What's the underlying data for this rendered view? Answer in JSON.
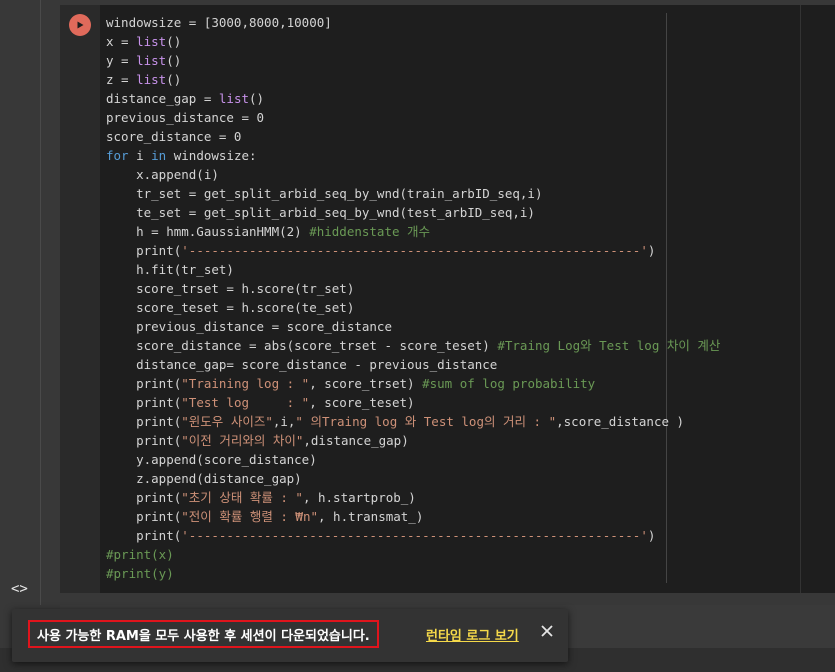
{
  "colors": {
    "string": "#ce9178",
    "comment": "#6a9955",
    "keyword": "#569cd6",
    "builtin": "#c792ea",
    "text": "#d4d4d4",
    "run_button": "#e06a5b",
    "toast_border": "#e0141c",
    "toast_link": "#f5d94a"
  },
  "left_rail": {
    "toggle_icon": "<>"
  },
  "cell": {
    "run_icon": "play-icon",
    "code_lines": [
      [
        [
          "windowsize = [3000,8000,10000]",
          "t"
        ]
      ],
      [
        [
          "x = ",
          "t"
        ],
        [
          "list",
          "b"
        ],
        [
          "()",
          "t"
        ]
      ],
      [
        [
          "y = ",
          "t"
        ],
        [
          "list",
          "b"
        ],
        [
          "()",
          "t"
        ]
      ],
      [
        [
          "z = ",
          "t"
        ],
        [
          "list",
          "b"
        ],
        [
          "()",
          "t"
        ]
      ],
      [
        [
          "distance_gap = ",
          "t"
        ],
        [
          "list",
          "b"
        ],
        [
          "()",
          "t"
        ]
      ],
      [
        [
          "previous_distance = 0",
          "t"
        ]
      ],
      [
        [
          "score_distance = 0",
          "t"
        ]
      ],
      [
        [
          "for",
          "k"
        ],
        [
          " i ",
          "t"
        ],
        [
          "in",
          "k"
        ],
        [
          " windowsize:",
          "t"
        ]
      ],
      [
        [
          "    x.append(i)",
          "t"
        ]
      ],
      [
        [
          "    tr_set = get_split_arbid_seq_by_wnd(train_arbID_seq,i)",
          "t"
        ]
      ],
      [
        [
          "    te_set = get_split_arbid_seq_by_wnd(test_arbID_seq,i)",
          "t"
        ]
      ],
      [
        [
          "    h = hmm.GaussianHMM(2) ",
          "t"
        ],
        [
          "#hiddenstate 개수",
          "c"
        ]
      ],
      [
        [
          "    print(",
          "t"
        ],
        [
          "'------------------------------------------------------------'",
          "s"
        ],
        [
          ")",
          "t"
        ]
      ],
      [
        [
          "    h.fit(tr_set)",
          "t"
        ]
      ],
      [
        [
          "    score_trset = h.score(tr_set)",
          "t"
        ]
      ],
      [
        [
          "    score_teset = h.score(te_set)",
          "t"
        ]
      ],
      [
        [
          "    previous_distance = score_distance",
          "t"
        ]
      ],
      [
        [
          "    score_distance = abs(score_trset - score_teset) ",
          "t"
        ],
        [
          "#Traing Log와 Test log 차이 계산",
          "c"
        ]
      ],
      [
        [
          "    distance_gap= score_distance - previous_distance",
          "t"
        ]
      ],
      [
        [
          "    print(",
          "t"
        ],
        [
          "\"Training log : \"",
          "s"
        ],
        [
          ", score_trset) ",
          "t"
        ],
        [
          "#sum of log probability",
          "c"
        ]
      ],
      [
        [
          "    print(",
          "t"
        ],
        [
          "\"Test log     : \"",
          "s"
        ],
        [
          ", score_teset)",
          "t"
        ]
      ],
      [
        [
          "    print(",
          "t"
        ],
        [
          "\"윈도우 사이즈\"",
          "s"
        ],
        [
          ",i,",
          "t"
        ],
        [
          "\" 의Traing log 와 Test log의 거리 : \"",
          "s"
        ],
        [
          ",score_distance )",
          "t"
        ]
      ],
      [
        [
          "    print(",
          "t"
        ],
        [
          "\"이전 거리와의 차이\"",
          "s"
        ],
        [
          ",distance_gap)",
          "t"
        ]
      ],
      [
        [
          "    y.append(score_distance)",
          "t"
        ]
      ],
      [
        [
          "    z.append(distance_gap)",
          "t"
        ]
      ],
      [
        [
          "    print(",
          "t"
        ],
        [
          "\"초기 상태 확률 : \"",
          "s"
        ],
        [
          ", h.startprob_)",
          "t"
        ]
      ],
      [
        [
          "    print(",
          "t"
        ],
        [
          "\"전이 확률 행렬 : ₩n\"",
          "s"
        ],
        [
          ", h.transmat_)",
          "t"
        ]
      ],
      [
        [
          "    print(",
          "t"
        ],
        [
          "'------------------------------------------------------------'",
          "s"
        ],
        [
          ")",
          "t"
        ]
      ],
      [
        [
          "#print(x)",
          "c"
        ]
      ],
      [
        [
          "#print(y)",
          "c"
        ]
      ]
    ]
  },
  "toast": {
    "message": "사용 가능한 RAM을 모두 사용한 후 세션이 다운되었습니다.",
    "link_label": "런타임 로그 보기",
    "close_icon": "close-icon"
  }
}
